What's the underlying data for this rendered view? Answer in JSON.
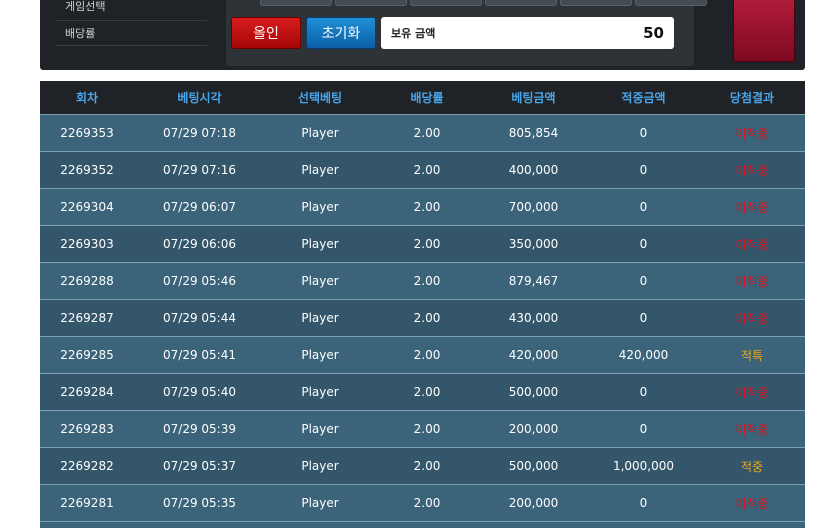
{
  "sidebar": {
    "items": [
      {
        "label": "게임선택"
      },
      {
        "label": "배당률"
      }
    ]
  },
  "controls": {
    "allin_label": "올인",
    "reset_label": "초기화",
    "balance_label": "보유 금액",
    "balance_value": "50"
  },
  "colors": {
    "header_text": "#4aa5e8",
    "row_odd": "#3b6379",
    "row_even": "#34566b",
    "miss": "#e0101c",
    "hit": "#f1a91b"
  },
  "table": {
    "headers": [
      "회차",
      "베팅시각",
      "선택베팅",
      "배당률",
      "베팅금액",
      "적중금액",
      "당첨결과"
    ],
    "rows": [
      {
        "round": "2269353",
        "time": "07/29 07:18",
        "pick": "Player",
        "odds": "2.00",
        "bet": "805,854",
        "win": "0",
        "result": "미적중",
        "status": "miss"
      },
      {
        "round": "2269352",
        "time": "07/29 07:16",
        "pick": "Player",
        "odds": "2.00",
        "bet": "400,000",
        "win": "0",
        "result": "미적중",
        "status": "miss"
      },
      {
        "round": "2269304",
        "time": "07/29 06:07",
        "pick": "Player",
        "odds": "2.00",
        "bet": "700,000",
        "win": "0",
        "result": "미적중",
        "status": "miss"
      },
      {
        "round": "2269303",
        "time": "07/29 06:06",
        "pick": "Player",
        "odds": "2.00",
        "bet": "350,000",
        "win": "0",
        "result": "미적중",
        "status": "miss"
      },
      {
        "round": "2269288",
        "time": "07/29 05:46",
        "pick": "Player",
        "odds": "2.00",
        "bet": "879,467",
        "win": "0",
        "result": "미적중",
        "status": "miss"
      },
      {
        "round": "2269287",
        "time": "07/29 05:44",
        "pick": "Player",
        "odds": "2.00",
        "bet": "430,000",
        "win": "0",
        "result": "미적중",
        "status": "miss"
      },
      {
        "round": "2269285",
        "time": "07/29 05:41",
        "pick": "Player",
        "odds": "2.00",
        "bet": "420,000",
        "win": "420,000",
        "result": "적특",
        "status": "hit"
      },
      {
        "round": "2269284",
        "time": "07/29 05:40",
        "pick": "Player",
        "odds": "2.00",
        "bet": "500,000",
        "win": "0",
        "result": "미적중",
        "status": "miss"
      },
      {
        "round": "2269283",
        "time": "07/29 05:39",
        "pick": "Player",
        "odds": "2.00",
        "bet": "200,000",
        "win": "0",
        "result": "미적중",
        "status": "miss"
      },
      {
        "round": "2269282",
        "time": "07/29 05:37",
        "pick": "Player",
        "odds": "2.00",
        "bet": "500,000",
        "win": "1,000,000",
        "result": "적중",
        "status": "hit"
      },
      {
        "round": "2269281",
        "time": "07/29 05:35",
        "pick": "Player",
        "odds": "2.00",
        "bet": "200,000",
        "win": "0",
        "result": "미적중",
        "status": "miss"
      }
    ]
  }
}
